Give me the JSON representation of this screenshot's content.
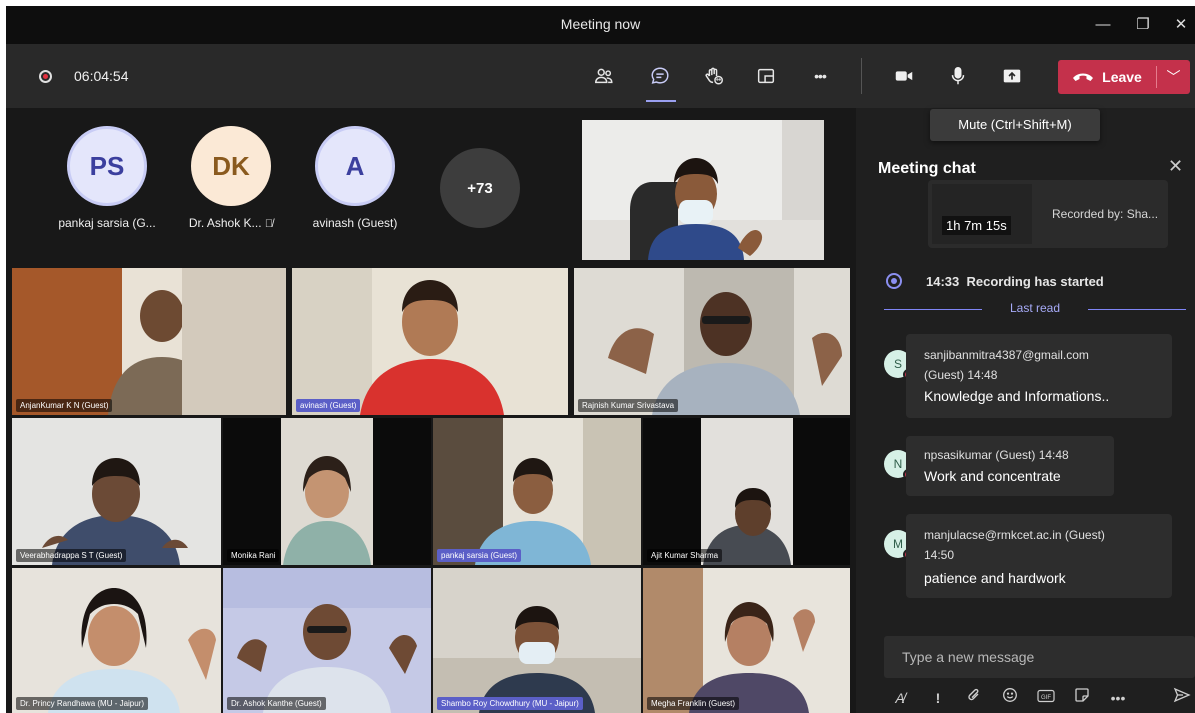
{
  "window": {
    "title": "Meeting now",
    "minimize_glyph": "—",
    "restore_glyph": "❐",
    "close_glyph": "✕"
  },
  "toolbar": {
    "recording_time": "06:04:54",
    "leave_label": "Leave",
    "icons": [
      "participants-icon",
      "chat-icon",
      "reactions-icon",
      "rooms-icon",
      "more-actions-icon",
      "camera-icon",
      "microphone-icon",
      "share-tray-icon"
    ],
    "more_glyph": "•••",
    "leave_color": "#c4314b"
  },
  "tooltip": {
    "text": "Mute (Ctrl+Shift+M)"
  },
  "stage": {
    "audio_participants": [
      {
        "initials": "PS",
        "name": "pankaj sarsia (G...",
        "bg": "#e4e6fb",
        "fg": "#3b3f9e",
        "muted": false
      },
      {
        "initials": "DK",
        "name": "Dr. Ashok K...",
        "bg": "#fbe9d6",
        "fg": "#8a5a1e",
        "muted": true
      },
      {
        "initials": "A",
        "name": "avinash (Guest)",
        "bg": "#e4e6fb",
        "fg": "#3b3f9e",
        "muted": false
      }
    ],
    "overflow_count": "+73",
    "video_tiles": [
      {
        "name": "AnjanKumar K N (Guest)",
        "highlight": false
      },
      {
        "name": "avinash (Guest)",
        "highlight": true
      },
      {
        "name": "Rajnish Kumar Srivastava",
        "highlight": false
      },
      {
        "name": "Veerabhadrappa S T (Guest)",
        "highlight": false
      },
      {
        "name": "Monika Rani",
        "highlight": false
      },
      {
        "name": "pankaj sarsia (Guest)",
        "highlight": true
      },
      {
        "name": "Ajit Kumar Sharma",
        "highlight": false
      },
      {
        "name": "Dr. Princy Randhawa (MU - Jaipur)",
        "highlight": false
      },
      {
        "name": "Dr. Ashok Kanthe (Guest)",
        "highlight": false
      },
      {
        "name": "Shambo Roy Chowdhury (MU - Jaipur)",
        "highlight": true
      },
      {
        "name": "Megha Franklin (Guest)",
        "highlight": false
      }
    ]
  },
  "chat": {
    "title": "Meeting chat",
    "recording_card": {
      "duration": "1h 7m 15s",
      "recorded_by": "Recorded by: Sha..."
    },
    "recording_started": {
      "time": "14:33",
      "text": "Recording has started"
    },
    "last_read_label": "Last read",
    "messages": [
      {
        "initial": "S",
        "sender": "sanjibanmitra4387@gmail.com",
        "sender_line2": "(Guest)   14:48",
        "body": "Knowledge and Informations.."
      },
      {
        "initial": "N",
        "sender": "npsasikumar (Guest)   14:48",
        "sender_line2": "",
        "body": "Work and concentrate"
      },
      {
        "initial": "M",
        "sender": "manjulacse@rmkcet.ac.in (Guest)",
        "sender_line2": "14:50",
        "body": "patience and hardwork"
      }
    ],
    "compose_placeholder": "Type a new message",
    "compose_tools": [
      "format-icon",
      "important-icon",
      "attach-icon",
      "emoji-icon",
      "gif-icon",
      "sticker-icon",
      "more-options-icon",
      "send-icon"
    ]
  }
}
